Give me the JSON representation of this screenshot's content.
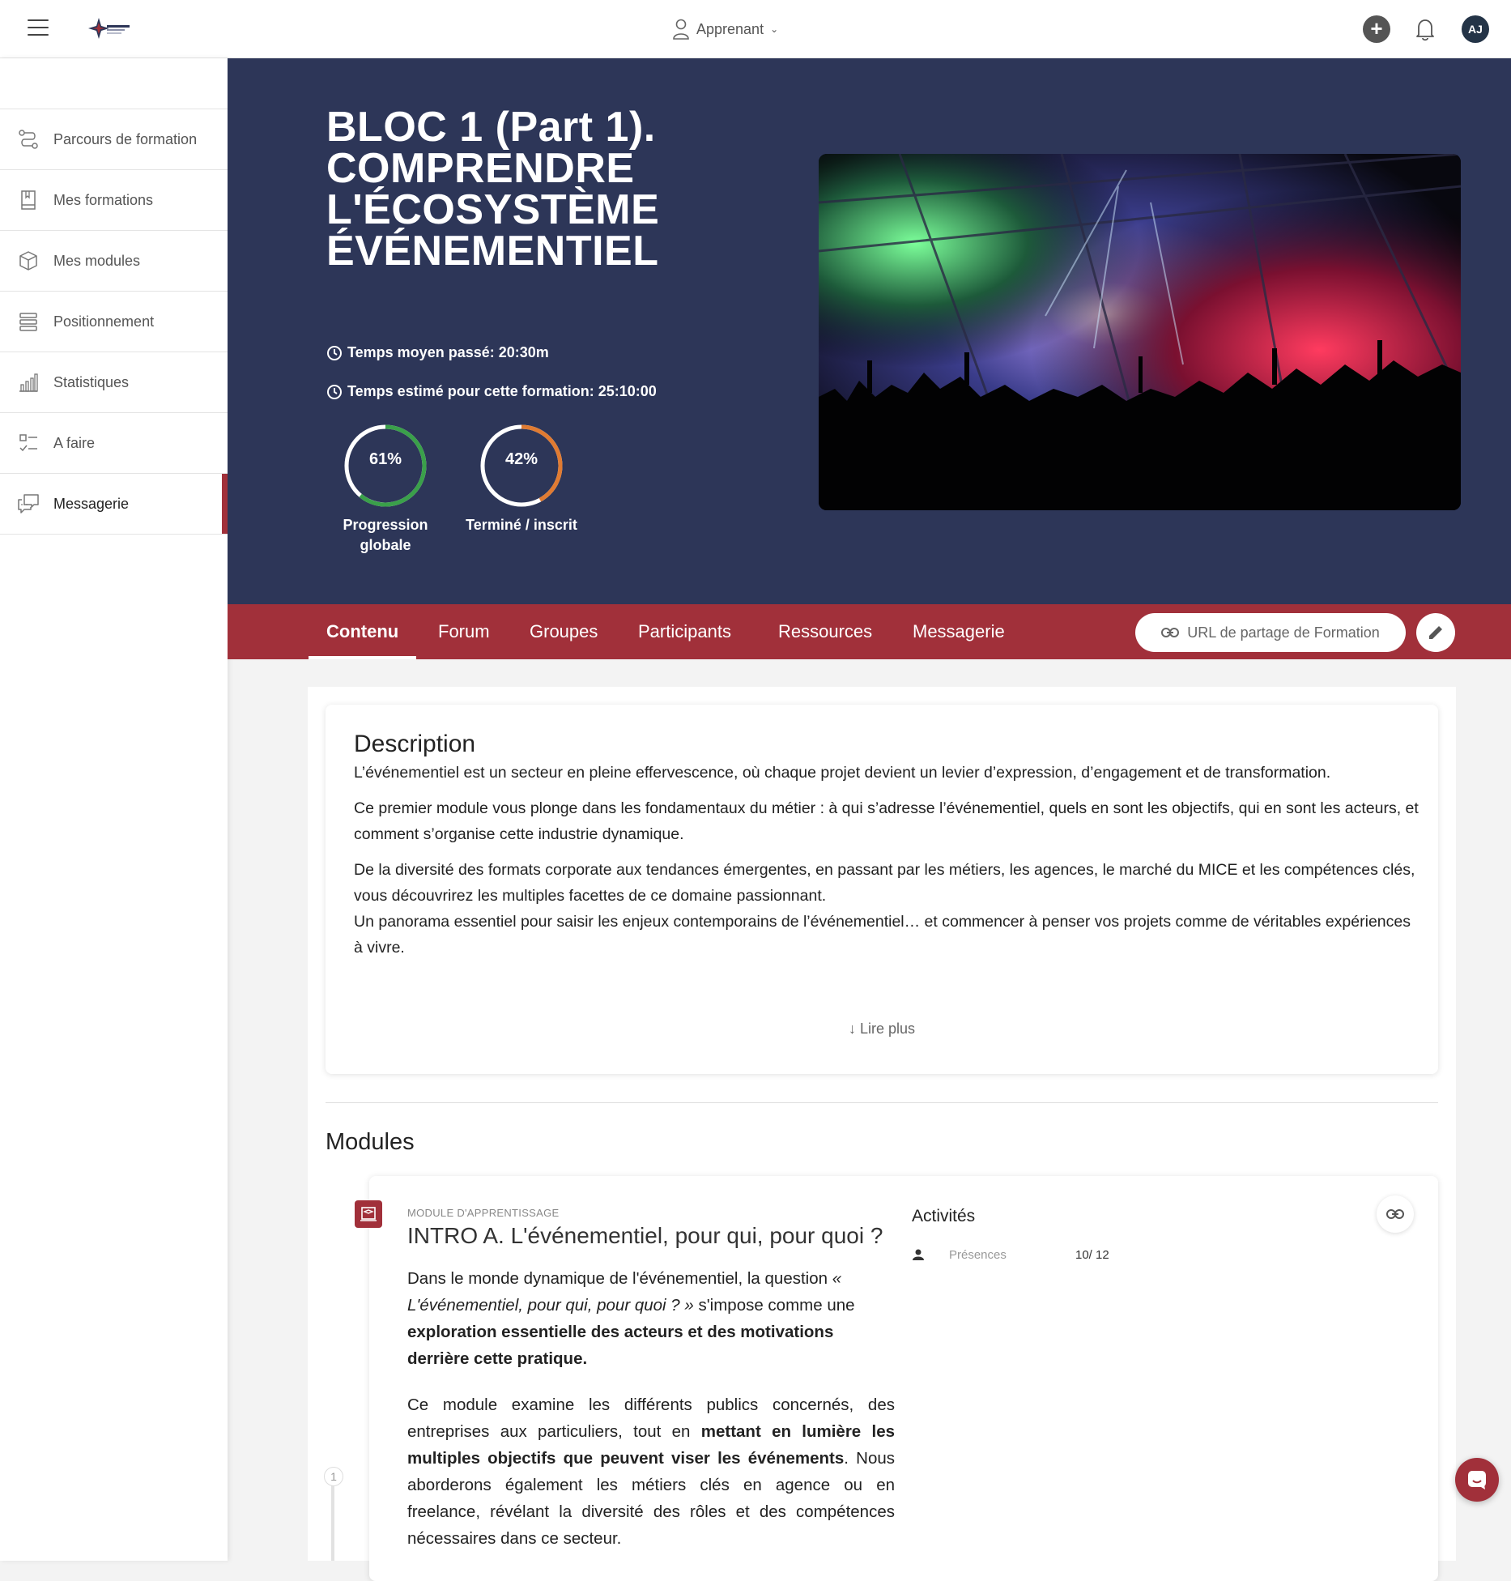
{
  "topbar": {
    "role_label": "Apprenant",
    "avatar_initials": "AJ"
  },
  "sidebar": {
    "items": [
      {
        "label": "Parcours de formation",
        "icon": "route-icon"
      },
      {
        "label": "Mes formations",
        "icon": "book-icon"
      },
      {
        "label": "Mes modules",
        "icon": "cube-icon"
      },
      {
        "label": "Positionnement",
        "icon": "stack-list-icon"
      },
      {
        "label": "Statistiques",
        "icon": "bar-chart-icon"
      },
      {
        "label": "A faire",
        "icon": "checklist-icon"
      },
      {
        "label": "Messagerie",
        "icon": "chat-bubbles-icon",
        "active": true
      }
    ]
  },
  "hero": {
    "title": "BLOC 1 (Part 1). COMPRENDRE L'ÉCOSYSTÈME ÉVÉNEMENTIEL",
    "avg_time": "Temps moyen passé: 20:30m",
    "est_time": "Temps estimé pour cette formation: 25:10:00",
    "progress": {
      "value": 61,
      "text": "61%",
      "label": "Progression globale",
      "color": "#3aa04a"
    },
    "completed": {
      "value": 42,
      "text": "42%",
      "label": "Terminé / inscrit",
      "color": "#e07b32"
    }
  },
  "tabs": {
    "items": [
      "Contenu",
      "Forum",
      "Groupes",
      "Participants",
      "Ressources",
      "Messagerie"
    ],
    "active": "Contenu",
    "share_label": "URL de partage de Formation"
  },
  "description": {
    "title": "Description",
    "p1": "L’événementiel est un secteur en pleine effervescence, où chaque projet devient un levier d’expression, d’engagement et de transformation.",
    "p2": "Ce premier module vous plonge dans les fondamentaux du métier : à qui s’adresse l’événementiel, quels en sont les objectifs, qui en sont les acteurs, et comment s’organise cette industrie dynamique.",
    "p3": "De la diversité des formats corporate aux tendances émergentes, en passant par les métiers, les agences, le marché du MICE et les compétences clés, vous découvrirez les multiples facettes de ce domaine passionnant.",
    "p4": "Un panorama essentiel pour saisir les enjeux contemporains de l’événementiel… et commencer à penser vos projets comme de véritables expériences à vivre.",
    "read_more": "Lire plus"
  },
  "modules": {
    "title": "Modules",
    "items": [
      {
        "step": "1",
        "type": "MODULE D'APPRENTISSAGE",
        "title": "INTRO A. L'événementiel, pour qui, pour quoi ?",
        "p1_a": "Dans le monde dynamique de l'événementiel, la question ",
        "p1_em": "« L'événementiel, pour qui, pour quoi ? »",
        "p1_b": " s'impose comme une ",
        "p1_strong": "exploration essentielle des acteurs et des motivations derrière cette pratique.",
        "p2_a": "Ce module examine les différents publics concernés, des entreprises aux particuliers, tout en ",
        "p2_strong": "mettant en lumière les multiples objectifs que peuvent viser les événements",
        "p2_b": ". Nous aborderons également les métiers clés en agence ou en freelance, révélant la diversité des rôles et des compétences nécessaires dans ce secteur.",
        "activities_title": "Activités",
        "activities": [
          {
            "label": "Présences",
            "value": "10/ 12",
            "icon": "person-icon"
          }
        ]
      }
    ]
  }
}
